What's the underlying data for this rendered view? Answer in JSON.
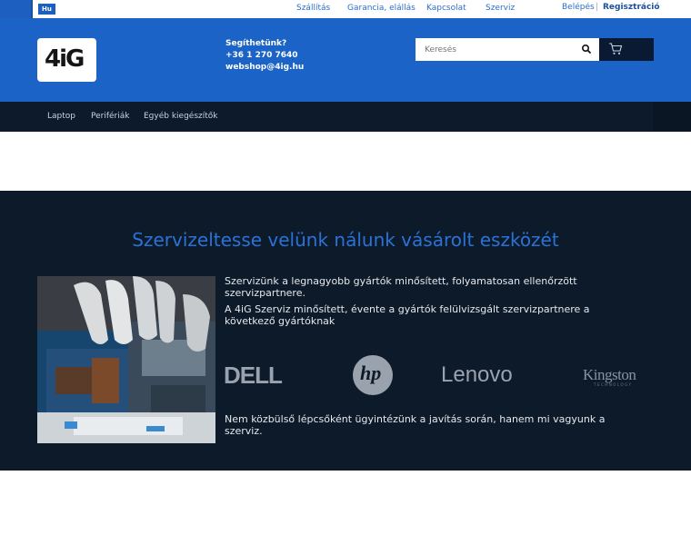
{
  "topbar": {
    "lang": "Hu",
    "links": [
      "Szállítás",
      "Garancia, elállás",
      "Kapcsolat",
      "Szerviz"
    ],
    "login": "Belépés",
    "separator": "|",
    "register": "Regisztráció"
  },
  "header": {
    "logo_text": "4iG",
    "contact_title": "Segíthetünk?",
    "phone": "+36 1 270 7640",
    "email": "webshop@4ig.hu",
    "search_placeholder": "Keresés"
  },
  "catnav": {
    "items": [
      "Laptop",
      "Perifériák",
      "Egyéb kiegészítők"
    ]
  },
  "service": {
    "headline": "Szervizeltesse velünk nálunk vásárolt eszközét",
    "para1": "Szervizünk a legnagyobb gyártók minősített, folyamatosan ellenőrzött szervizpartnere.",
    "para2": "A 4iG Szerviz minősített, évente a gyártók felülvizsgált szervizpartnere a következő gyártóknak",
    "brands": [
      "DELL",
      "hp",
      "Lenovo",
      "Kingston"
    ],
    "kingston_sub": "TECHNOLOGY",
    "para3": "Nem közbülső lépcsőként ügyintézünk a javítás során, hanem mi vagyunk a szerviz."
  },
  "colors": {
    "brand_blue": "#1b63c6",
    "dark_bg": "#0d1a2a",
    "headline_blue": "#2b72d8"
  }
}
